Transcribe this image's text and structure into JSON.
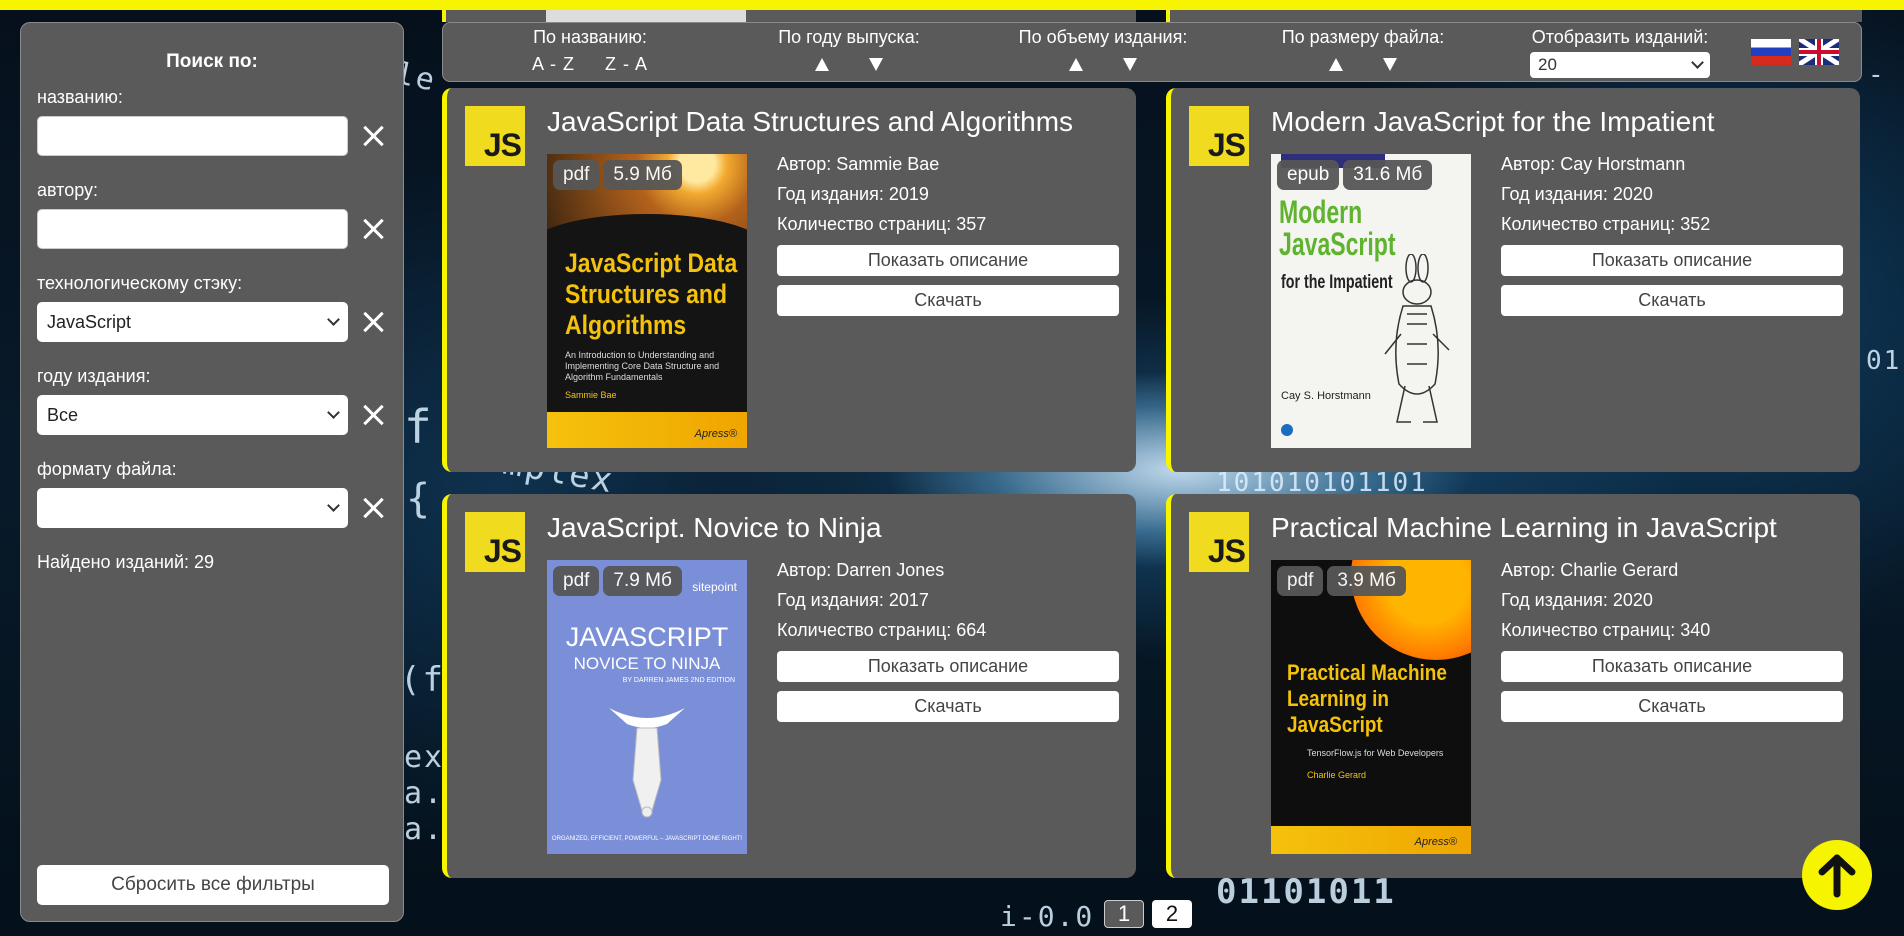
{
  "sidebar": {
    "title": "Поиск по:",
    "filters": [
      {
        "label": "названию:",
        "type": "text",
        "value": ""
      },
      {
        "label": "автору:",
        "type": "text",
        "value": ""
      },
      {
        "label": "технологическому стэку:",
        "type": "select",
        "value": "JavaScript"
      },
      {
        "label": "году издания:",
        "type": "select",
        "value": "Все"
      },
      {
        "label": "формату файла:",
        "type": "select",
        "value": ""
      }
    ],
    "found": "Найдено изданий: 29",
    "reset": "Сбросить все фильтры"
  },
  "sortbar": {
    "by_name": {
      "label": "По названию:",
      "asc": "A - Z",
      "desc": "Z - A"
    },
    "by_year": {
      "label": "По году выпуска:"
    },
    "by_volume": {
      "label": "По объему издания:"
    },
    "by_size": {
      "label": "По размеру файла:"
    },
    "per_page": {
      "label": "Отобразить изданий:",
      "value": "20"
    }
  },
  "languages": [
    "ru-flag",
    "uk-flag"
  ],
  "books": [
    {
      "title": "JavaScript Data Structures and Algorithms",
      "format": "pdf",
      "size": "5.9 Мб",
      "author": "Автор: Sammie Bae",
      "year": "Год издания: 2019",
      "pages": "Количество страниц: 357",
      "cover_title": "JavaScript Data Structures and Algorithms",
      "cover_subtitle": "An Introduction to Understanding and Implementing Core Data Structure and Algorithm Fundamentals",
      "cover_author": "Sammie Bae",
      "cover_publisher": "Apress®"
    },
    {
      "title": "Modern JavaScript for the Impatient",
      "format": "epub",
      "size": "31.6 Мб",
      "author": "Автор: Cay Horstmann",
      "year": "Год издания: 2020",
      "pages": "Количество страниц: 352",
      "cover_title": "Modern JavaScript",
      "cover_subtitle": "for the Impatient",
      "cover_author": "Cay S. Horstmann"
    },
    {
      "title": "JavaScript. Novice to Ninja",
      "format": "pdf",
      "size": "7.9 Мб",
      "author": "Автор: Darren Jones",
      "year": "Год издания: 2017",
      "pages": "Количество страниц: 664",
      "cover_site": "sitepoint",
      "cover_title": "JAVASCRIPT",
      "cover_subtitle": "NOVICE TO NINJA",
      "cover_edition": "BY DARREN JAMES 2ND EDITION",
      "cover_footer": "ORGANIZED, EFFICIENT, POWERFUL – JAVASCRIPT DONE RIGHT!"
    },
    {
      "title": "Practical Machine Learning in JavaScript",
      "format": "pdf",
      "size": "3.9 Мб",
      "author": "Автор: Charlie Gerard",
      "year": "Год издания: 2020",
      "pages": "Количество страниц: 340",
      "cover_title": "Practical Machine Learning in JavaScript",
      "cover_subtitle": "TensorFlow.js for Web Developers",
      "cover_author": "Charlie Gerard",
      "cover_publisher": "Apress®"
    }
  ],
  "card_buttons": {
    "describe": "Показать описание",
    "download": "Скачать"
  },
  "js_logo": "JS",
  "pagination": {
    "pages": [
      "1",
      "2"
    ],
    "active": "1"
  },
  "background_code": [
    "le",
    "f",
    "{",
    "(f",
    "ex",
    "a.",
    "a.",
    "emplex",
    "01101011",
    "101010101101",
    "01",
    "-",
    "i-0.0"
  ],
  "colors": {
    "accent": "#f7f400",
    "panel": "#5a5a5a"
  }
}
